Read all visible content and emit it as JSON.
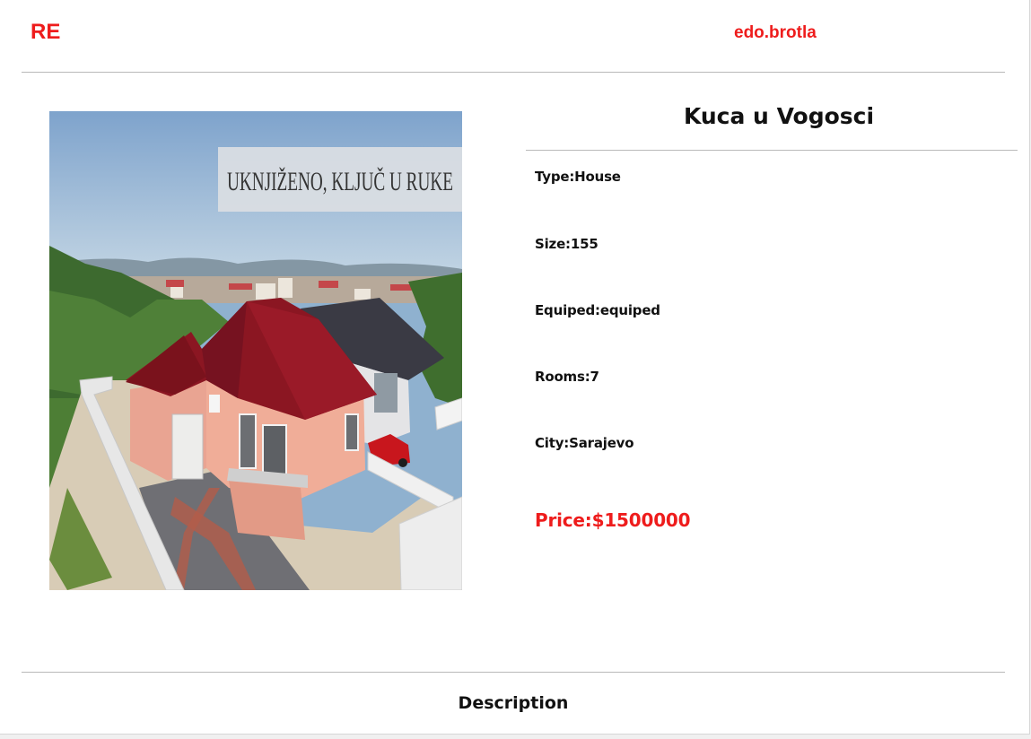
{
  "header": {
    "brand": "RE",
    "username": "edo.brotla"
  },
  "listing": {
    "title": "Kuca u Vogosci",
    "photo_banner_text": "UKNJIŽENO, KLJUČ U RUKE",
    "type_label": "Type:",
    "type_value": "House",
    "size_label": "Size:",
    "size_value": "155",
    "equipped_label": "Equiped:",
    "equipped_value": "equiped",
    "rooms_label": "Rooms:",
    "rooms_value": "7",
    "city_label": "City:",
    "city_value": "Sarajevo",
    "price_label": "Price:",
    "price_value": "$1500000"
  },
  "description": {
    "heading": "Description"
  },
  "colors": {
    "accent": "#ee1c1c",
    "roof_red": "#8b1622",
    "wall_pink": "#e9a492",
    "roof_dark": "#3a3a44"
  }
}
